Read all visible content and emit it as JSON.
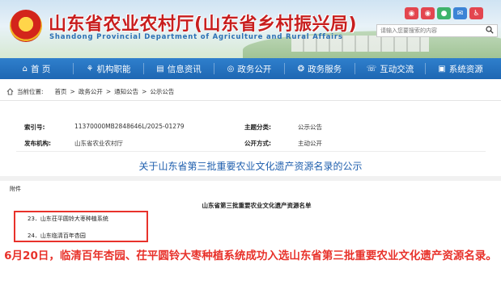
{
  "header": {
    "title": "山东省农业农村厅(山东省乡村振兴局)",
    "subtitle": "Shandong Provincial Department of Agriculture and Rural Affairs",
    "search_placeholder": "请输入您要搜索的内容",
    "social_icons": [
      "weibo-icon",
      "weibo-icon",
      "wechat-icon",
      "mail-icon",
      "accessibility-icon"
    ]
  },
  "nav": {
    "items": [
      {
        "label": "首 页",
        "icon": "home-icon"
      },
      {
        "label": "机构职能",
        "icon": "org-icon"
      },
      {
        "label": "信息资讯",
        "icon": "news-icon"
      },
      {
        "label": "政务公开",
        "icon": "gov-open-icon"
      },
      {
        "label": "政务服务",
        "icon": "service-icon"
      },
      {
        "label": "互动交流",
        "icon": "chat-icon"
      },
      {
        "label": "系统资源",
        "icon": "system-icon"
      }
    ]
  },
  "breadcrumb": {
    "prefix": "当前位置:",
    "items": [
      "首页",
      "政务公开",
      "通知公告",
      "公示公告"
    ],
    "sep": ">"
  },
  "meta": {
    "index_label": "索引号:",
    "index_value": "11370000MB2848646L/2025-01279",
    "topic_label": "主题分类:",
    "topic_value": "公示公告",
    "publisher_label": "发布机构:",
    "publisher_value": "山东省农业农村厅",
    "mode_label": "公开方式:",
    "mode_value": "主动公开"
  },
  "article": {
    "title": "关于山东省第三批重要农业文化遗产资源名录的公示",
    "attachment_label": "附件",
    "list_title": "山东省第三批重要农业文化遗产资源名单",
    "items": [
      "23．山东茌平圆铃大枣种植系统",
      "24．山东临清百年杏园"
    ]
  },
  "caption": "6月20日，临清百年杏园、茌平圆铃大枣种植系统成功入选山东省第三批重要农业文化遗产资源名录。",
  "colors": {
    "nav_blue": "#1e67b3",
    "title_red": "#c81e1e",
    "link_blue": "#1f5fae",
    "highlight_red": "#e8322b"
  }
}
